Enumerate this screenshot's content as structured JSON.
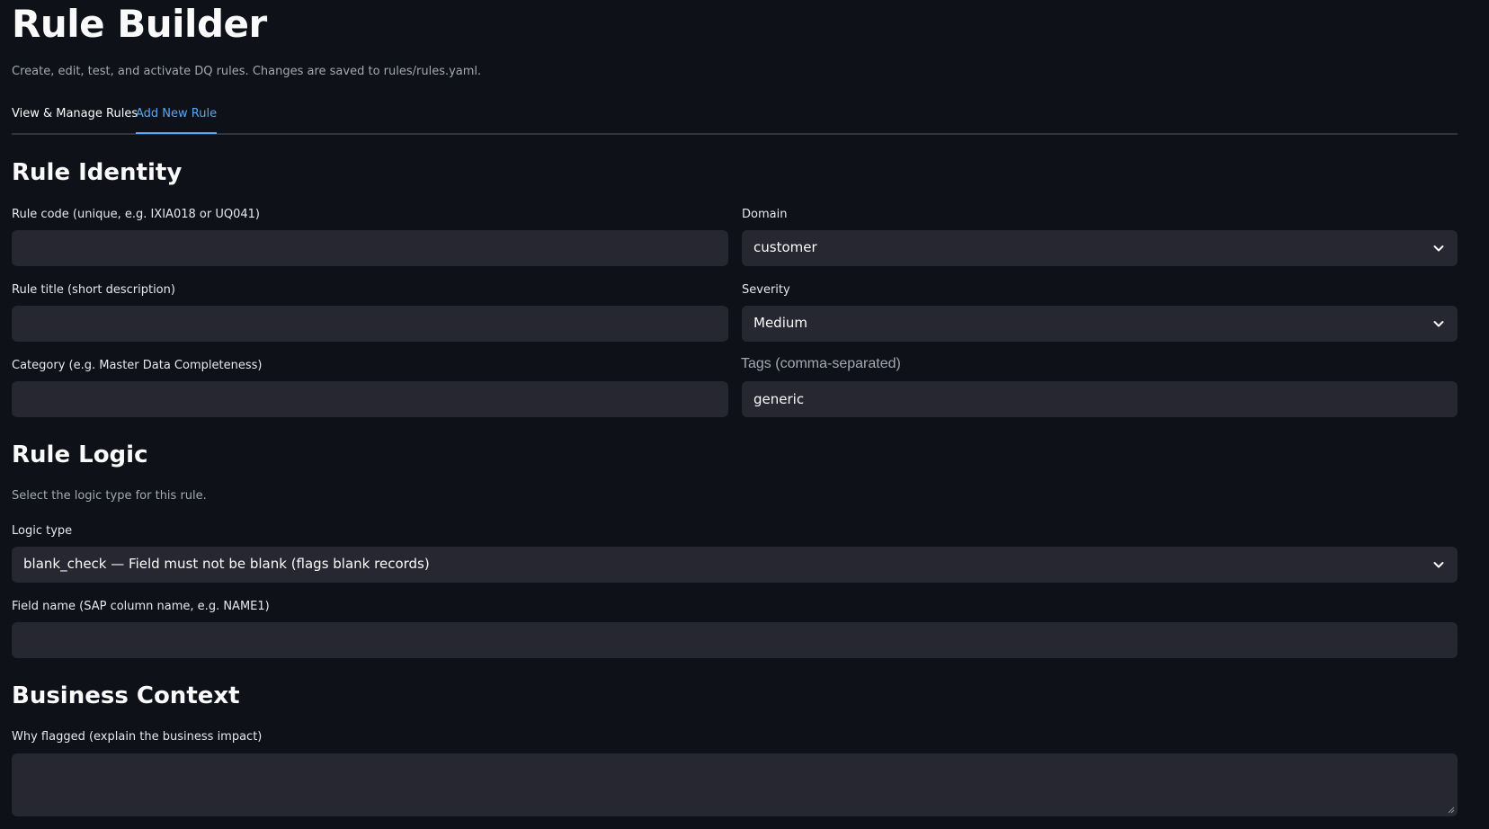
{
  "header": {
    "title": "Rule Builder",
    "subtitle": "Create, edit, test, and activate DQ rules. Changes are saved to rules/rules.yaml."
  },
  "tabs": [
    {
      "label": "View & Manage Rules",
      "active": false
    },
    {
      "label": "Add New Rule",
      "active": true
    }
  ],
  "identity": {
    "section_title": "Rule Identity",
    "rule_code": {
      "label": "Rule code (unique, e.g. IXIA018 or UQ041)",
      "value": "",
      "placeholder": ""
    },
    "domain": {
      "label": "Domain",
      "value": "customer"
    },
    "rule_title": {
      "label": "Rule title (short description)",
      "value": "",
      "placeholder": ""
    },
    "severity": {
      "label": "Severity",
      "value": "Medium"
    },
    "category": {
      "label": "Category (e.g. Master Data Completeness)",
      "value": "",
      "placeholder": ""
    },
    "tags": {
      "label": "Tags (comma-separated)",
      "value": "generic"
    }
  },
  "logic": {
    "section_title": "Rule Logic",
    "description": "Select the logic type for this rule.",
    "logic_type": {
      "label": "Logic type",
      "value": "blank_check — Field must not be blank (flags blank records)"
    },
    "field_name": {
      "label": "Field name (SAP column name, e.g. NAME1)",
      "value": "",
      "placeholder": ""
    }
  },
  "business": {
    "section_title": "Business Context",
    "why_flagged": {
      "label": "Why flagged (explain the business impact)",
      "value": "",
      "placeholder": ""
    }
  },
  "icons": {
    "dropdown": "chevron-down-icon",
    "resize": "resize-grip-icon"
  },
  "colors": {
    "background": "#0e1117",
    "input_background": "#262730",
    "accent": "#5aa7f0",
    "text": "#fafafa",
    "muted_text": "#a3a8b4"
  }
}
